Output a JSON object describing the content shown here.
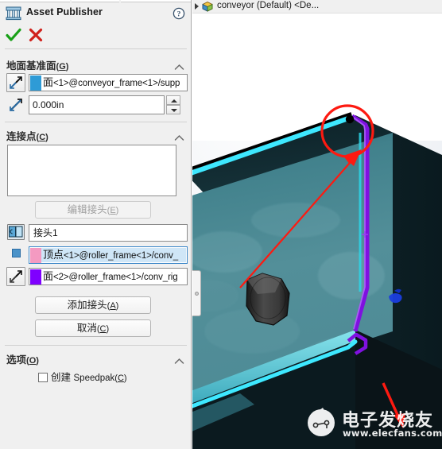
{
  "panel": {
    "title": "Asset Publisher",
    "icon": "asset-publisher-icon",
    "help_icon": "help-question-icon",
    "ok_icon": "green-check-icon",
    "cancel_icon": "red-x-icon",
    "sections": [
      {
        "id": "ground-plane",
        "label": "地面基准面",
        "mnemonic": "G",
        "collapse_icon": "chevron-up-icon",
        "face_selection": {
          "icon": "face-select-icon",
          "swatch_color": "#2e9bd6",
          "cjk": "面",
          "ascii": "<1>@conveyor_frame<1>/supp"
        },
        "offset": {
          "icon": "offset-distance-icon",
          "value": "0.000in",
          "spinner_up": "spinner-up-icon",
          "spinner_down": "spinner-down-icon"
        }
      },
      {
        "id": "connection-points",
        "label": "连接点",
        "mnemonic": "C",
        "collapse_icon": "chevron-up-icon",
        "list_items": [],
        "edit_connector_button": {
          "label": "编辑接头",
          "mnemonic": "E",
          "enabled": false
        },
        "connector_name": {
          "icon": "connector-icon",
          "value": "接头1"
        },
        "vertex_selection": {
          "icon": "vertex-point-icon",
          "swatch_color": "#f49ac1",
          "cjk": "顶点",
          "ascii": "<1>@roller_frame<1>/conv_",
          "selected": true
        },
        "face_selection": {
          "icon": "face-select-icon",
          "swatch_color": "#7f00ff",
          "cjk": "面",
          "ascii": "<2>@roller_frame<1>/conv_rig"
        },
        "add_connector_button": {
          "label": "添加接头",
          "mnemonic": "A"
        },
        "cancel_button": {
          "label": "取消",
          "mnemonic": "C"
        }
      },
      {
        "id": "options",
        "label": "选项",
        "mnemonic": "O",
        "collapse_icon": "chevron-up-icon",
        "checkbox": {
          "label_cjk": "创建",
          "label_ascii": "Speedpak",
          "mnemonic": "C",
          "checked": false
        }
      }
    ]
  },
  "viewport": {
    "tree_item": {
      "expand_icon": "tree-expand-arrow-icon",
      "icon": "assembly-part-icon",
      "label": "conveyor (Default) <De..."
    },
    "panel_handle_icon": "panel-resize-handle-icon",
    "annotations": {
      "circle_color": "#fd1a11",
      "arrow_color": "#fd1a11",
      "vertex_marker_color": "#000000",
      "highlight_edge_cyan": "#3ee8ff",
      "highlight_edge_purple": "#7f11e0"
    },
    "model_colors": {
      "face_light": "#4e8d99",
      "face_dark": "#12272c",
      "background": "#ffffff",
      "bolt": "#3a3a3a"
    },
    "watermark": {
      "cn": "电子发烧友",
      "url": "www.elecfans.com",
      "logo_icon": "elecfans-logo-icon"
    }
  }
}
